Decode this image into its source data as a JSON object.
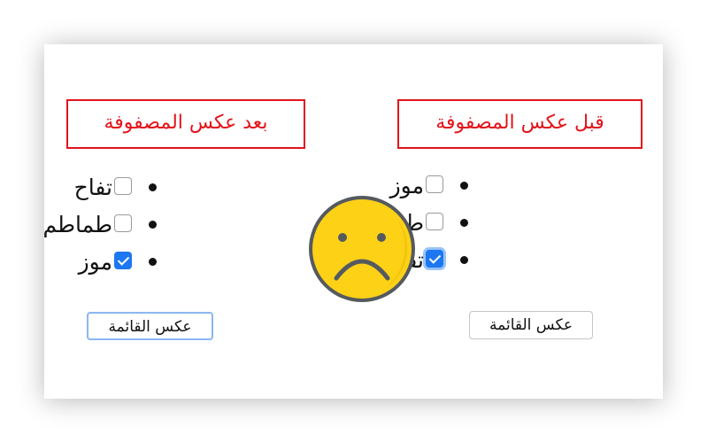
{
  "before": {
    "heading": "قبل عكس المصفوفة",
    "items": [
      {
        "label": "موز",
        "checked": false
      },
      {
        "label": "طماطم",
        "checked": false
      },
      {
        "label": "تفاح",
        "checked": true
      }
    ],
    "button_label": "عكس القائمة"
  },
  "after": {
    "heading": "بعد عكس المصفوفة",
    "items": [
      {
        "label": "تفاح",
        "checked": false
      },
      {
        "label": "طماطم",
        "checked": false
      },
      {
        "label": "موز",
        "checked": true
      }
    ],
    "button_label": "عكس القائمة"
  },
  "face": {
    "icon": "sad-face-icon",
    "fill": "#fcd116",
    "outline": "#555a5f"
  },
  "colors": {
    "heading": "#e3131b",
    "checkbox_checked": "#1d77f2"
  }
}
